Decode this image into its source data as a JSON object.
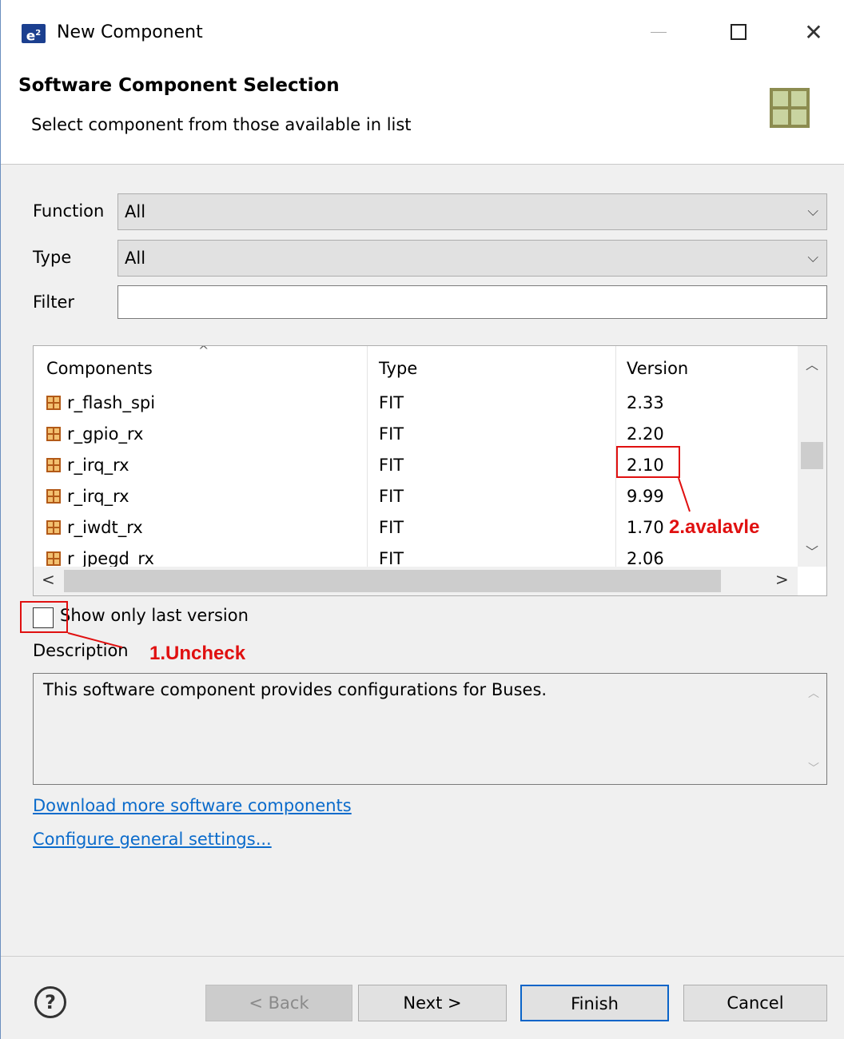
{
  "window": {
    "icon_text": "e",
    "icon_sup": "2",
    "title": "New Component",
    "minimize": "—",
    "close": "✕"
  },
  "header": {
    "title": "Software Component Selection",
    "subtitle": "Select component from those available in list"
  },
  "form": {
    "function_label": "Function",
    "function_value": "All",
    "type_label": "Type",
    "type_value": "All",
    "filter_label": "Filter",
    "filter_value": ""
  },
  "table": {
    "columns": [
      "Components",
      "Type",
      "Version"
    ],
    "rows": [
      {
        "name": "r_flash_spi",
        "type": "FIT",
        "version": "2.33"
      },
      {
        "name": "r_gpio_rx",
        "type": "FIT",
        "version": "2.20"
      },
      {
        "name": "r_irq_rx",
        "type": "FIT",
        "version": "2.10"
      },
      {
        "name": "r_irq_rx",
        "type": "FIT",
        "version": "9.99"
      },
      {
        "name": "r_iwdt_rx",
        "type": "FIT",
        "version": "1.70"
      },
      {
        "name": "r_jpegd_rx",
        "type": "FIT",
        "version": "2.06"
      }
    ]
  },
  "checkbox": {
    "label": "Show only last version",
    "checked": false
  },
  "description": {
    "label": "Description",
    "text": "This software component provides configurations for Buses."
  },
  "links": {
    "download": "Download more software components",
    "configure": "Configure general settings..."
  },
  "buttons": {
    "help": "?",
    "back": "< Back",
    "next": "Next >",
    "finish": "Finish",
    "cancel": "Cancel"
  },
  "annotations": {
    "step1": "1.Uncheck",
    "step2": "2.avalavle",
    "color": "#e01010"
  },
  "colors": {
    "link": "#0b6bcb",
    "default_button_border": "#0a64c8"
  }
}
